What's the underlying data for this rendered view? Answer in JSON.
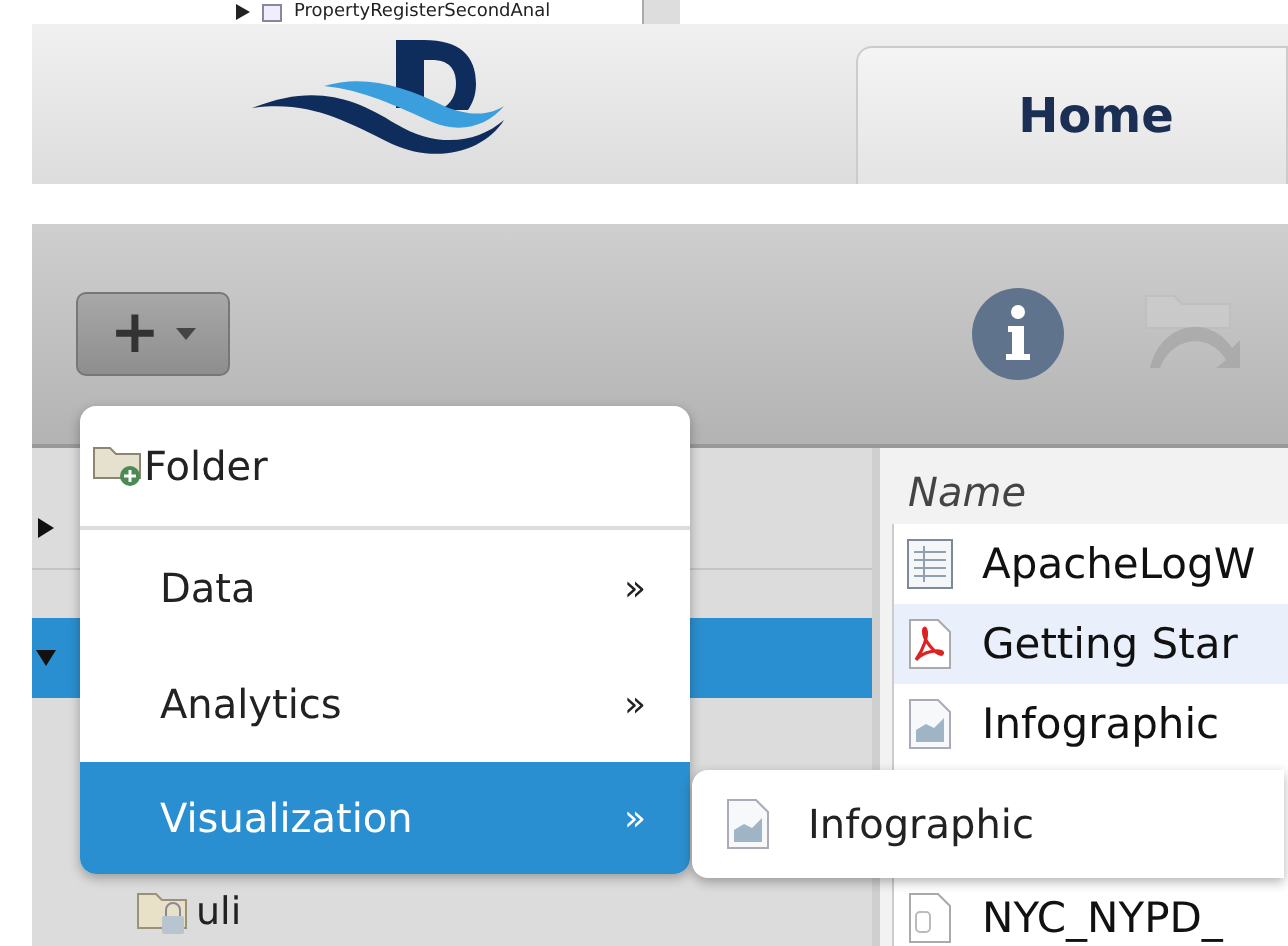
{
  "top_strip": {
    "label": "PropertyRegisterSecondAnal"
  },
  "header": {
    "tabs": [
      {
        "label": "Home",
        "selected": true
      }
    ]
  },
  "toolbar": {
    "add_button": {
      "label": "+"
    },
    "info": {
      "disabled": false
    },
    "open_folder": {
      "disabled": true
    }
  },
  "tree": {
    "rows": [
      {
        "label": "",
        "expanded": false,
        "selected": false
      },
      {
        "label": "",
        "expanded": true,
        "selected": true
      },
      {
        "label": "uli",
        "selected": false
      }
    ]
  },
  "file_list": {
    "columns": [
      "Name"
    ],
    "rows": [
      {
        "name": "ApacheLogW",
        "kind": "table",
        "selected": false
      },
      {
        "name": "Getting Star",
        "kind": "pdf",
        "selected": true
      },
      {
        "name": "Infographic",
        "kind": "infographic",
        "selected": false
      },
      {
        "name": "NYC_NYPD_",
        "kind": "file",
        "selected": false
      }
    ]
  },
  "menu": {
    "items": [
      {
        "label": "Folder",
        "kind": "folder",
        "submenu": false,
        "selected": false
      },
      {
        "label": "Data",
        "kind": "item",
        "submenu": true,
        "selected": false
      },
      {
        "label": "Analytics",
        "kind": "item",
        "submenu": true,
        "selected": false
      },
      {
        "label": "Visualization",
        "kind": "item",
        "submenu": true,
        "selected": true
      }
    ],
    "arrow": "»",
    "submenu": {
      "items": [
        {
          "label": "Infographic",
          "kind": "infographic"
        }
      ]
    }
  }
}
